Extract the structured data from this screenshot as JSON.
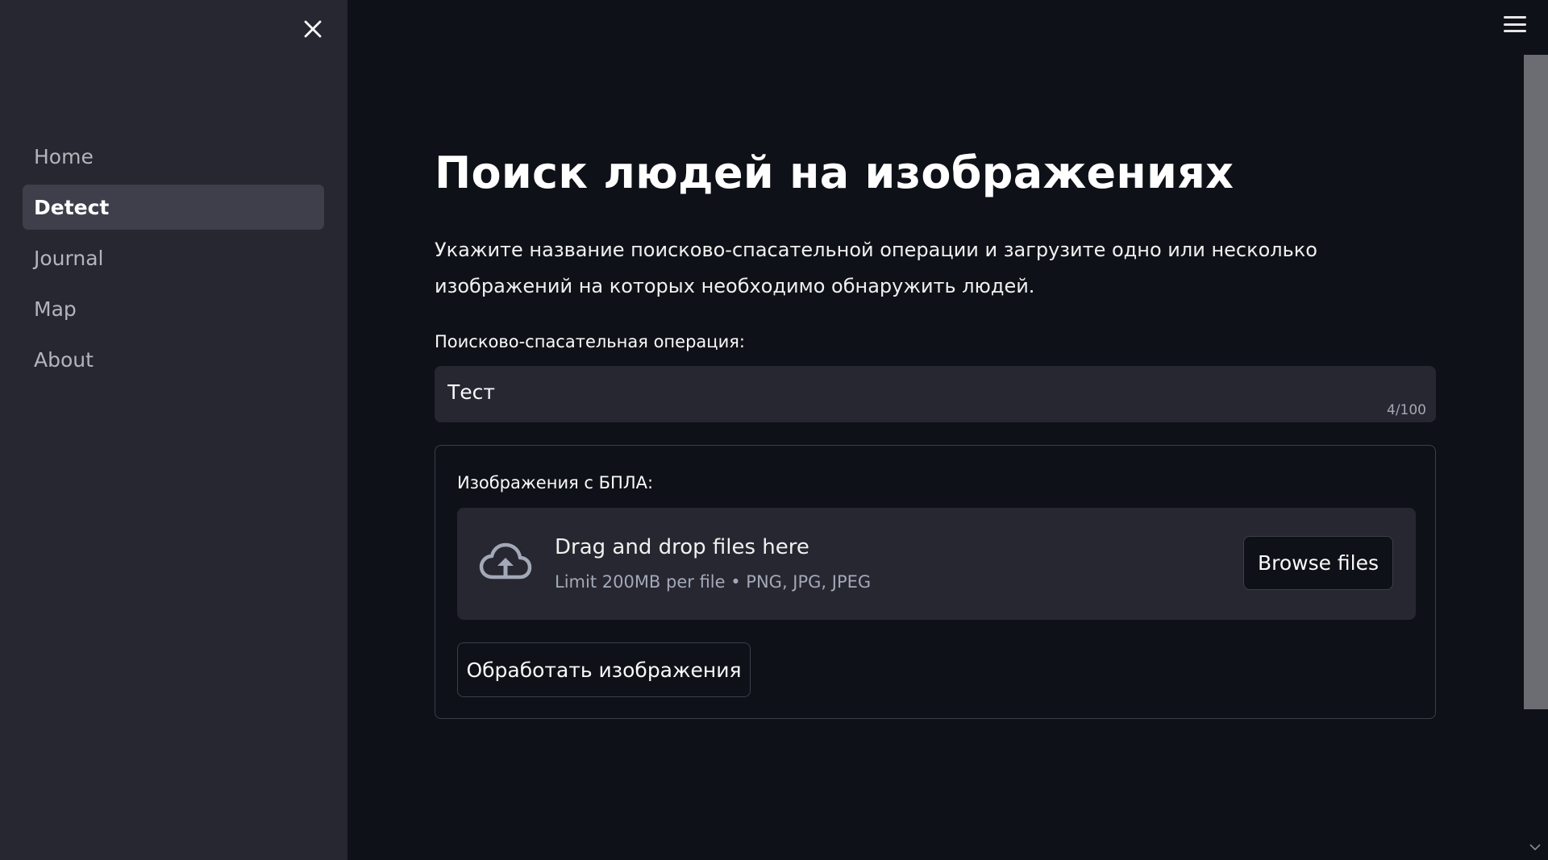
{
  "sidebar": {
    "close_icon": "close-icon",
    "items": [
      {
        "label": "Home",
        "active": false
      },
      {
        "label": "Detect",
        "active": true
      },
      {
        "label": "Journal",
        "active": false
      },
      {
        "label": "Map",
        "active": false
      },
      {
        "label": "About",
        "active": false
      }
    ]
  },
  "header": {
    "menu_icon": "hamburger-menu-icon"
  },
  "main": {
    "title": "Поиск людей на изображениях",
    "intro": "Укажите название поисково-спасательной операции и загрузите одно или несколько изображений на которых необходимо обнаружить людей.",
    "operation": {
      "label": "Поисково-спасательная операция:",
      "value": "Тест",
      "char_count": "4/100"
    },
    "upload": {
      "label": "Изображения с БПЛА:",
      "icon": "cloud-upload-icon",
      "drop_title": "Drag and drop files here",
      "drop_limit": "Limit 200MB per file • PNG, JPG, JPEG",
      "browse_label": "Browse files"
    },
    "process_label": "Обработать изображения"
  },
  "colors": {
    "background": "#0e1117",
    "sidebar": "#262730",
    "sidebar_active": "#3e3f4b",
    "input_bg": "#262730",
    "border": "#3c3f49",
    "muted_text": "#a3a8b8"
  }
}
